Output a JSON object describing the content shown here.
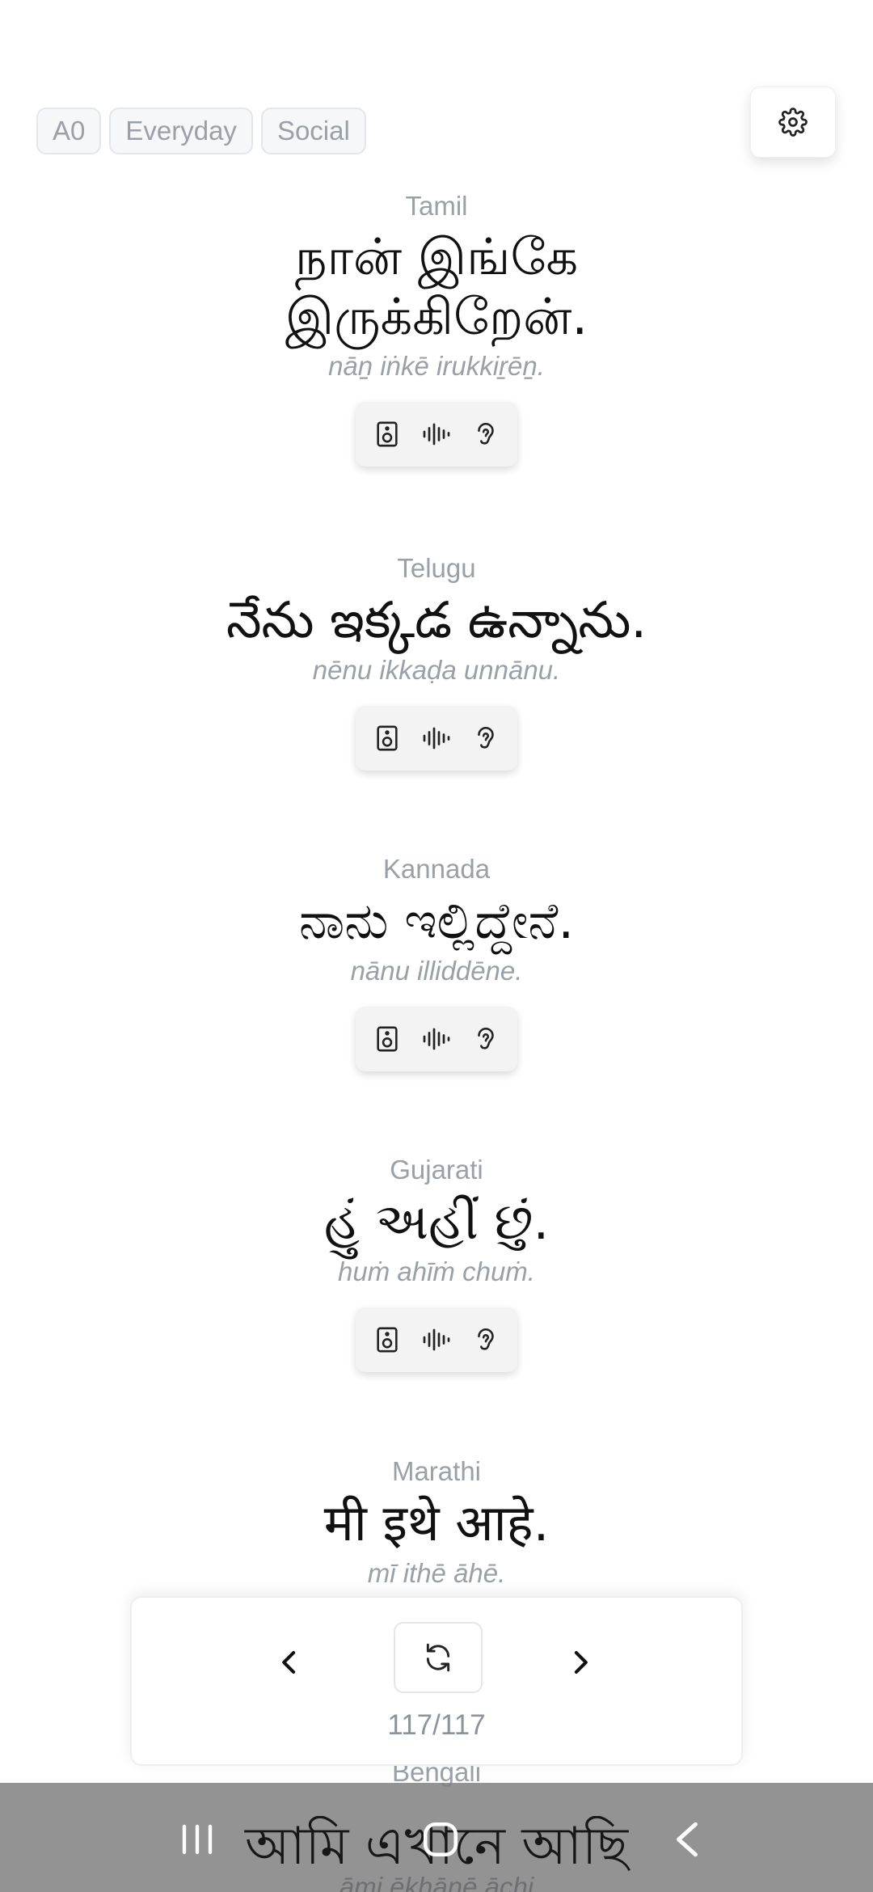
{
  "tags": [
    "A0",
    "Everyday",
    "Social"
  ],
  "entries": [
    {
      "language": "Tamil",
      "phrase": "நான் இங்கே இருக்கிறேன்.",
      "translit": "nāṉ iṅkē irukkiṟēṉ."
    },
    {
      "language": "Telugu",
      "phrase": "నేను ఇక్కడ ఉన్నాను.",
      "translit": "nēnu ikkaḍa unnānu."
    },
    {
      "language": "Kannada",
      "phrase": "ನಾನು ಇಲ್ಲಿದ್ದೇನೆ.",
      "translit": "nānu illiddēne."
    },
    {
      "language": "Gujarati",
      "phrase": "હું અહીં છું.",
      "translit": "huṁ ahīṁ chuṁ."
    },
    {
      "language": "Marathi",
      "phrase": "मी इथे आहे.",
      "translit": "mī ithē āhē."
    },
    {
      "language": "Bengali",
      "phrase": "আমি এখানে আছি",
      "translit": "āmi ēkhānē āchi"
    }
  ],
  "navigation": {
    "counter": "117/117"
  },
  "icons": {
    "settings": "gear-icon",
    "speaker": "speaker-icon",
    "waveform": "waveform-icon",
    "ear": "ear-icon",
    "prev": "chevron-left-icon",
    "next": "chevron-right-icon",
    "refresh": "refresh-icon"
  }
}
